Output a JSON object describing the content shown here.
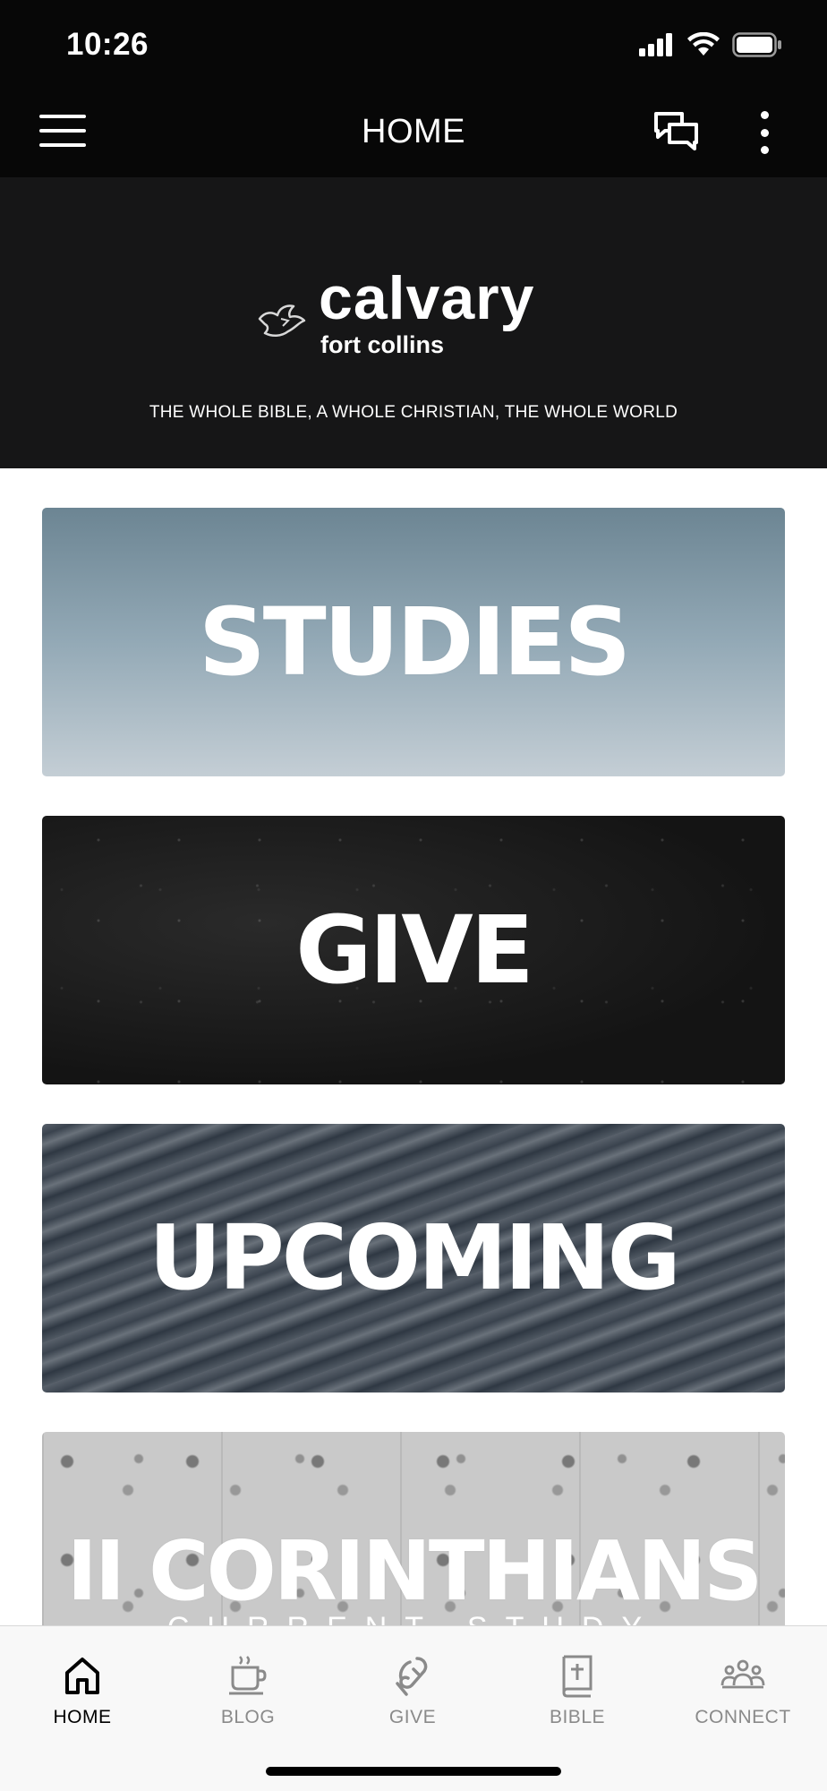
{
  "status_bar": {
    "time": "10:26",
    "signal_icon": "cellular-signal-icon",
    "wifi_icon": "wifi-icon",
    "battery_icon": "battery-icon"
  },
  "header": {
    "title": "HOME",
    "menu_icon": "hamburger-menu-icon",
    "chat_icon": "chat-bubbles-icon",
    "more_icon": "more-vertical-icon"
  },
  "hero": {
    "logo_name": "calvary",
    "logo_sub": "fort collins",
    "tagline": "THE WHOLE BIBLE, A WHOLE CHRISTIAN, THE WHOLE WORLD"
  },
  "cards": [
    {
      "title": "STUDIES"
    },
    {
      "title": "GIVE"
    },
    {
      "title": "UPCOMING"
    },
    {
      "title": "II CORINTHIANS",
      "subtitle": "CURRENT STUDY"
    }
  ],
  "tabs": [
    {
      "label": "HOME",
      "icon": "home-icon",
      "active": true
    },
    {
      "label": "BLOG",
      "icon": "coffee-cup-icon",
      "active": false
    },
    {
      "label": "GIVE",
      "icon": "give-hand-icon",
      "active": false
    },
    {
      "label": "BIBLE",
      "icon": "bible-icon",
      "active": false
    },
    {
      "label": "CONNECT",
      "icon": "people-group-icon",
      "active": false
    }
  ],
  "colors": {
    "header_bg": "#070707",
    "hero_bg": "#161617",
    "tab_active": "#000000",
    "tab_inactive": "#8a8a8a"
  }
}
